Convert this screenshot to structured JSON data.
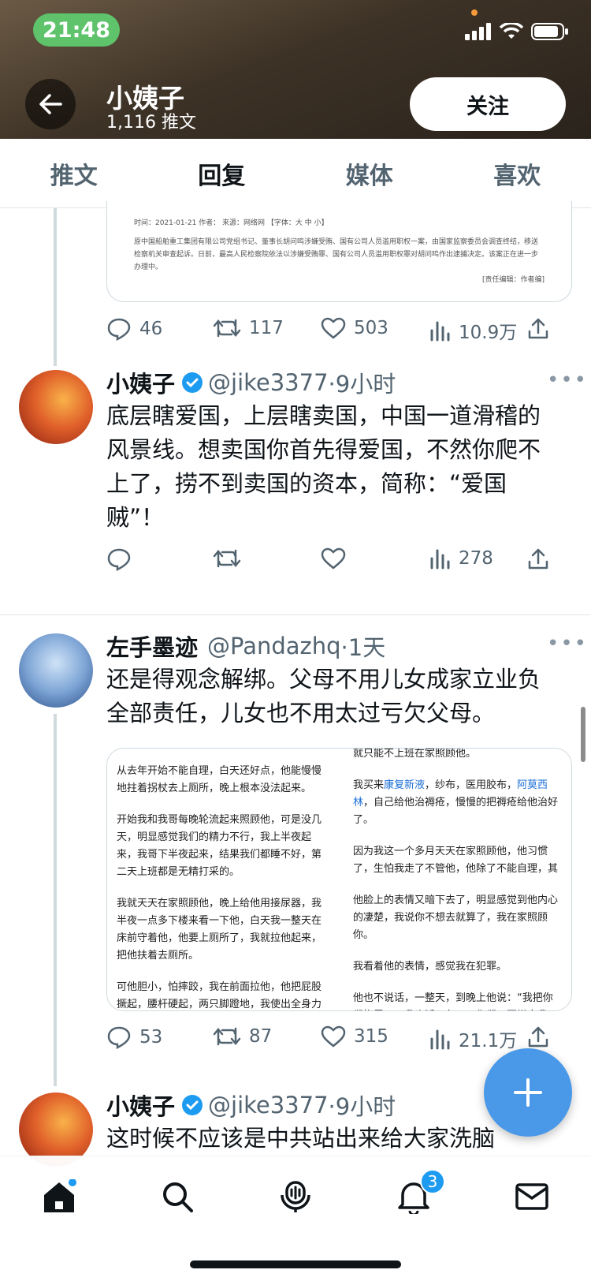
{
  "status_bar": {
    "time": "21:48"
  },
  "profile": {
    "name": "小姨子",
    "tweet_count": "1,116 推文",
    "follow_label": "关注"
  },
  "tabs": [
    {
      "label": "推文",
      "active": false
    },
    {
      "label": "回复",
      "active": true
    },
    {
      "label": "媒体",
      "active": false
    },
    {
      "label": "喜欢",
      "active": false
    }
  ],
  "top_card": {
    "meta": "时间：2021-01-21    作者：    来源：网络网                                    【字体：大  中  小】",
    "body": "原中国船舶重工集团有限公司党组书记、董事长胡问鸣涉嫌受贿、国有公司人员滥用职权一案，由国家监察委员会调查终结，移送检察机关审查起诉。日前，最高人民检察院依法以涉嫌受贿罪、国有公司人员滥用职权罪对胡问鸣作出逮捕决定。该案正在进一步办理中。",
    "editor": "[责任编辑：作者编]"
  },
  "top_actions": {
    "replies": "46",
    "retweets": "117",
    "likes": "503",
    "views": "10.9万"
  },
  "tweet1": {
    "name": "小姨子",
    "handle": "@jike3377",
    "time": "·9小时",
    "text": "底层瞎爱国，上层瞎卖国，中国一道滑稽的风景线。想卖国你首先得爱国，不然你爬不上了，捞不到卖国的资本，简称：“爱国贼”！",
    "views": "278"
  },
  "tweet2": {
    "name": "左手墨迹",
    "handle": "@Pandazhq",
    "time": "·1天",
    "text": "还是得观念解绑。父母不用儿女成家立业负全部责任，儿女也不用太过亏欠父母。",
    "image_left": [
      "从去年开始不能自理，白天还好点，他能慢慢地拄着拐杖去上厕所，晚上根本没法起来。",
      "开始我和我哥每晚轮流起来照顾他，可是没几天，明显感觉我们的精力不行，我上半夜起来，我哥下半夜起来，结果我们都睡不好，第二天上班都是无精打采的。",
      "我就天天在家照顾他，晚上给他用接尿器，我半夜一点多下楼来看一下他，白天我一整天在床前守着他，他要上厕所了，我就拉他起来，把他扶着去厕所。",
      "可他胆小，怕摔跤，我在前面拉他，他把屁股撅起，腰杆硬起，两只脚蹬地，我使出全身力"
    ],
    "image_right_top": "就只能不上班在家照顾他。",
    "image_right_buy_prefix": "我买来",
    "image_right_link1": "康复新液",
    "image_right_mid": "，纱布，医用胶布，",
    "image_right_link2": "阿莫西林",
    "image_right_suffix": "，自己给他治褥疮，慢慢的把褥疮给他治好了。",
    "image_right_rest": [
      "因为我这一个多月天天在家照顾他，他习惯了，生怕我走了不管他，他除了不能自理，其",
      "他脸上的表情又暗下去了，明显感觉到他内心的凄楚，我说你不想去就算了，我在家照顾你。",
      "我看着他的表情，感觉我在犯罪。",
      "他也不说话，一整天，到晚上他说：“我把你们拖累了，我也活不久了，你们不要嫌弃我。”"
    ],
    "replies": "53",
    "retweets": "87",
    "likes": "315",
    "views": "21.1万"
  },
  "tweet3": {
    "name": "小姨子",
    "handle": "@jike3377",
    "time": "·9小时",
    "text": "这时候不应该是中共站出来给大家洗脑"
  },
  "nav": {
    "notifications_badge": "3"
  },
  "colors": {
    "accent": "#1d9bf0",
    "fab": "#4a99e9",
    "follow_bg": "#ffffff"
  }
}
